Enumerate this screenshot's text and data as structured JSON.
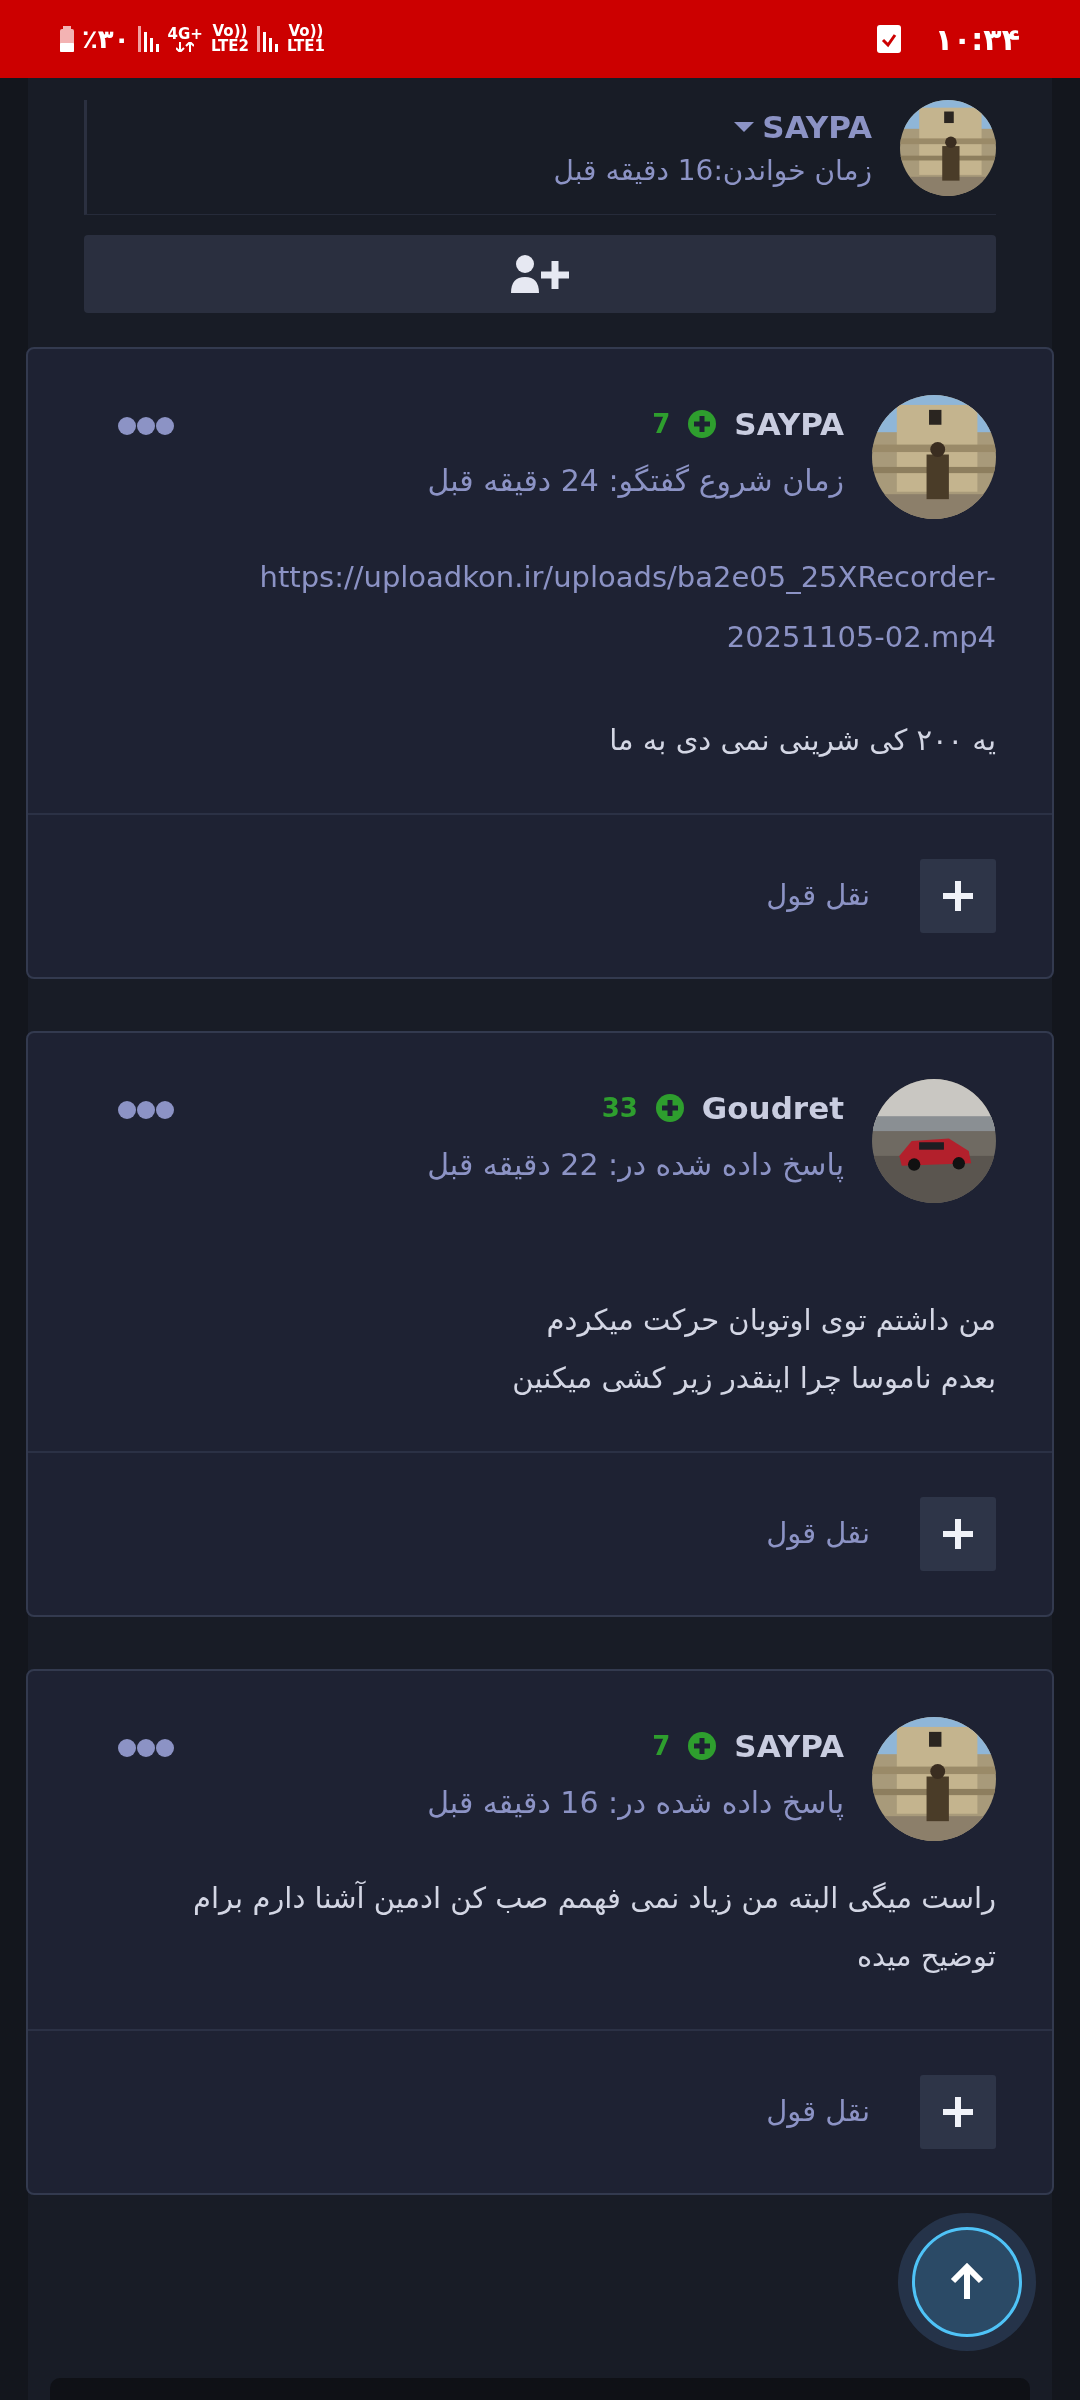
{
  "status_bar": {
    "battery": "٪۳۰",
    "network": "4G+",
    "volte_1": "Vo))",
    "lte_1": "LTE2",
    "volte_2": "Vo))",
    "lte_2": "LTE1",
    "time": "۱۰:۳۴"
  },
  "reader": {
    "name": "SAYPA",
    "read_time": "زمان خواندن:16 دقیقه قبل"
  },
  "posts": [
    {
      "author": "SAYPA",
      "reputation": "7",
      "timestamp": "زمان شروع گفتگو: 24 دقیقه قبل",
      "paragraphs": [
        {
          "kind": "link",
          "text": "https://uploadkon.ir/uploads/ba2e05_25XRecorder-20251105-02.mp4"
        },
        {
          "kind": "text",
          "text": "یه ۲۰۰ کی شرینی نمی دی به ما"
        }
      ],
      "quote_label": "نقل قول"
    },
    {
      "author": "Goudret",
      "reputation": "33",
      "timestamp": "پاسخ داده شده در: 22 دقیقه قبل",
      "paragraphs": [
        {
          "kind": "text",
          "text": "من داشتم توی اوتوبان حرکت میکردم\nبعدم ناموسا چرا اینقدر زیر کشی میکنین"
        }
      ],
      "quote_label": "نقل قول"
    },
    {
      "author": "SAYPA",
      "reputation": "7",
      "timestamp": "پاسخ داده شده در: 16 دقیقه قبل",
      "paragraphs": [
        {
          "kind": "text",
          "text": "راست میگی البته من زیاد نمی فهمم صب کن ادمین آشنا دارم برام توضیح میده"
        }
      ],
      "quote_label": "نقل قول"
    }
  ]
}
